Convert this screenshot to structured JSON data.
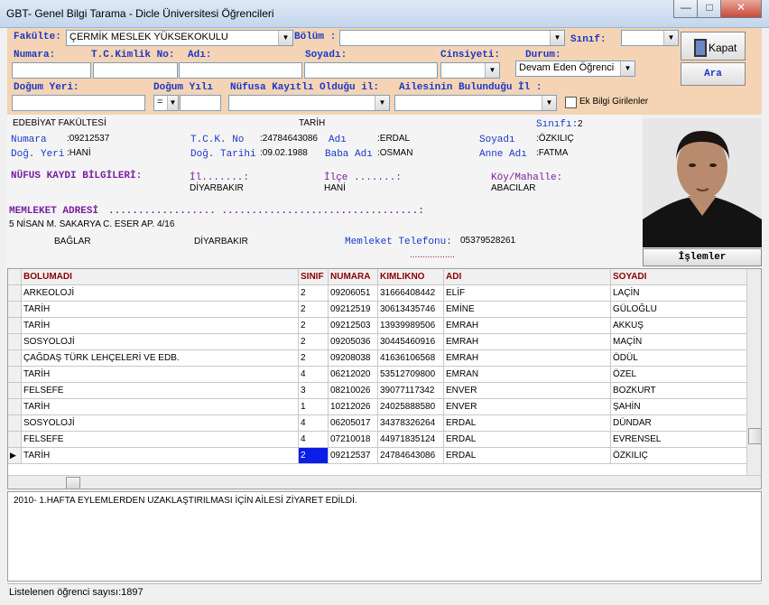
{
  "window": {
    "title": "GBT- Genel Bilgi Tarama - Dicle Üniversitesi Öğrencileri",
    "minimize": "—",
    "maximize": "□",
    "close": "✕"
  },
  "filter": {
    "fakulte_label": "Fakülte:",
    "fakulte_value": "ÇERMİK  MESLEK YÜKSEKOKULU",
    "bolum_label": "Bölüm :",
    "bolum_value": "",
    "sinif_label": "Sınıf:",
    "sinif_value": "",
    "numara_label": "Numara:",
    "numara_value": "",
    "tc_label": "T.C.Kimlik No:",
    "tc_value": "",
    "adi_label": "Adı:",
    "adi_value": "",
    "soyadi_label": "Soyadı:",
    "soyadi_value": "",
    "cinsiyeti_label": "Cinsiyeti:",
    "cinsiyeti_value": "",
    "durum_label": "Durum:",
    "durum_value": "Devam Eden Öğrenci",
    "dogum_yeri_label": "Doğum Yeri:",
    "dogum_yeri_value": "",
    "dogum_yili_label": "Doğum Yılı",
    "dogum_yili_op": "=",
    "dogum_yili_value": "",
    "nufus_label": "Nüfusa Kayıtlı Olduğu il:",
    "nufus_value": "",
    "aile_label": "Ailesinin Bulunduğu İl :",
    "aile_value": "",
    "ek_bilgi_label": "Ek Bilgi Girilenler",
    "kapat_label": "Kapat",
    "ara_label": "Ara"
  },
  "student": {
    "fakulte": "EDEBİYAT FAKÜLTESİ",
    "bolum": "TARİH",
    "sinif_label": "Sınıfı:",
    "sinif": "2",
    "numara_label": "Numara",
    "numara": ":09212537",
    "tck_label": "T.C.K. No",
    "tck": ":24784643086",
    "adi_label": "Adı",
    "adi": ":ERDAL",
    "soyadi_label": "Soyadı",
    "soyadi": ":ÖZKILIÇ",
    "dog_yeri_label": "Doğ. Yeri",
    "dog_yeri": ":HANİ",
    "dog_tarihi_label": "Doğ. Tarihi",
    "dog_tarihi": ":09.02.1988",
    "baba_label": "Baba Adı",
    "baba": ":OSMAN",
    "anne_label": "Anne Adı",
    "anne": ":FATMA",
    "nufus_title": "NÜFUS KAYDI BİLGİLERİ:",
    "il_label": "İl.......:",
    "il": "DİYARBAKIR",
    "ilce_label": "İlçe .......:",
    "ilce": "HANİ",
    "koy_label": "Köy/Mahalle:",
    "koy": "ABACILAR",
    "memleket_title": "MEMLEKET ADRESİ",
    "memleket_dots": ".................. .................................:",
    "adres1": "5 NİSAN M. SAKARYA C. ESER AP. 4/16",
    "adres_ilce": "BAĞLAR",
    "adres_il": "DİYARBAKIR",
    "tel_label": "Memleket Telefonu:",
    "tel": "05379528261",
    "tel_dots": "..................",
    "islemler_label": "İşlemler"
  },
  "grid": {
    "headers": [
      "BOLUMADI",
      "SINIF",
      "NUMARA",
      "KIMLIKNO",
      "ADI",
      "SOYADI"
    ],
    "rows": [
      [
        "ARKEOLOJİ",
        "2",
        "09206051",
        "31666408442",
        "ELİF",
        "LAÇİN"
      ],
      [
        "TARİH",
        "2",
        "09212519",
        "30613435746",
        "EMİNE",
        "GÜLOĞLU"
      ],
      [
        "TARİH",
        "2",
        "09212503",
        "13939989506",
        "EMRAH",
        "AKKUŞ"
      ],
      [
        "SOSYOLOJİ",
        "2",
        "09205036",
        "30445460916",
        "EMRAH",
        "MAÇİN"
      ],
      [
        "ÇAĞDAŞ TÜRK LEHÇELERİ VE EDB.",
        "2",
        "09208038",
        "41636106568",
        "EMRAH",
        "ÖDÜL"
      ],
      [
        "TARİH",
        "4",
        "06212020",
        "53512709800",
        "EMRAN",
        "ÖZEL"
      ],
      [
        "FELSEFE",
        "3",
        "08210026",
        "39077117342",
        "ENVER",
        "BOZKURT"
      ],
      [
        "TARİH",
        "1",
        "10212026",
        "24025888580",
        "ENVER",
        "ŞAHİN"
      ],
      [
        "SOSYOLOJİ",
        "4",
        "06205017",
        "34378326264",
        "ERDAL",
        "DÜNDAR"
      ],
      [
        "FELSEFE",
        "4",
        "07210018",
        "44971835124",
        "ERDAL",
        "EVRENSEL"
      ],
      [
        "TARİH",
        "2",
        "09212537",
        "24784643086",
        "ERDAL",
        "ÖZKILIÇ"
      ]
    ],
    "current_marker": "▶"
  },
  "note": "2010- 1.HAFTA EYLEMLERDEN UZAKLAŞTIRILMASI İÇİN AİLESİ ZİYARET EDİLDİ.",
  "status": "Listelenen öğrenci sayısı:1897"
}
